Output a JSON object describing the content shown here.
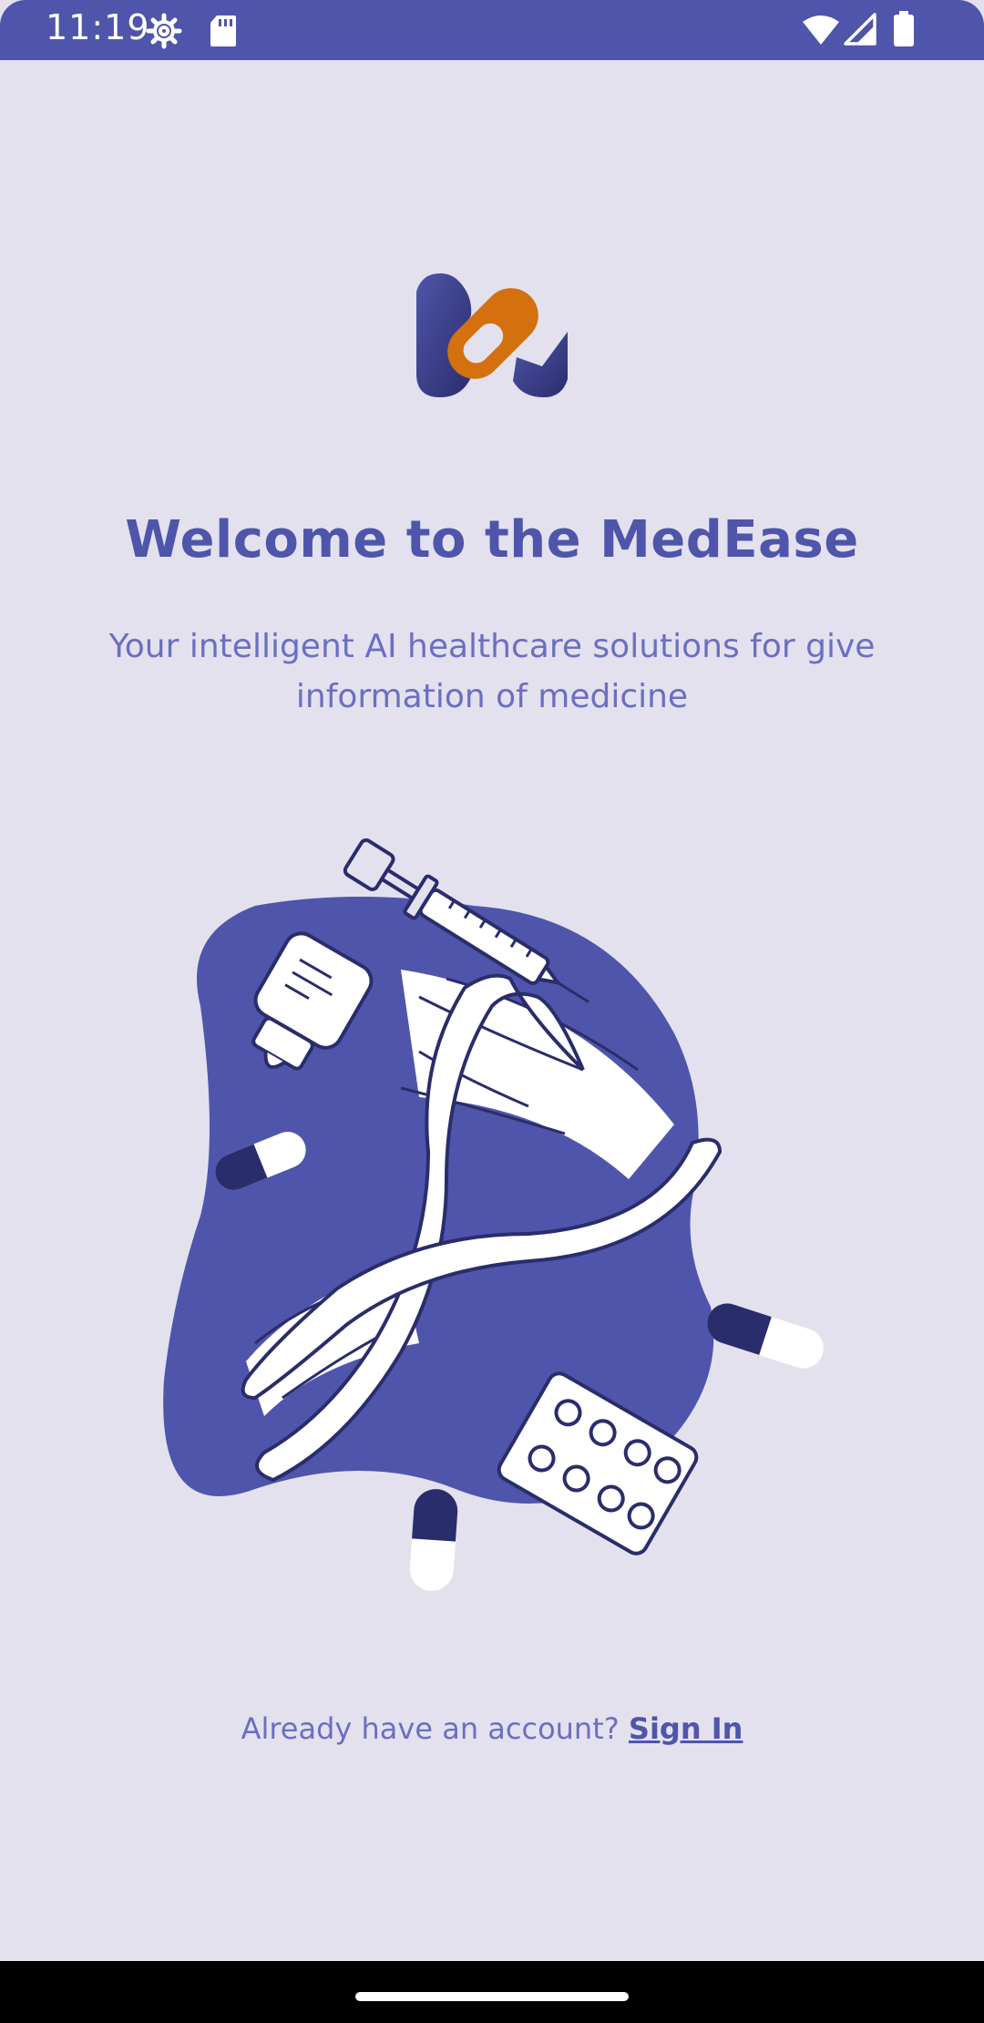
{
  "status_bar": {
    "time": "11:19",
    "icons": [
      "settings-icon",
      "sd-card-icon",
      "wifi-icon",
      "signal-icon",
      "battery-icon"
    ],
    "background": "#4F55AA"
  },
  "app": {
    "logo_icon": "pill-logo-icon",
    "title": "Welcome to the MedEase",
    "subtitle": "Your intelligent AI healthcare solutions for give information of medicine",
    "illustration_icon": "dna-medicine-illustration",
    "signin_prompt": "Already have an account?",
    "signin_link": "Sign In"
  },
  "colors": {
    "background": "#E3E1EE",
    "primary": "#4F55AA",
    "primary_dark": "#2A2D6B",
    "accent": "#D4700E",
    "text_secondary": "#6B6FC0"
  },
  "nav_bar": {
    "home_indicator": "home-indicator"
  }
}
